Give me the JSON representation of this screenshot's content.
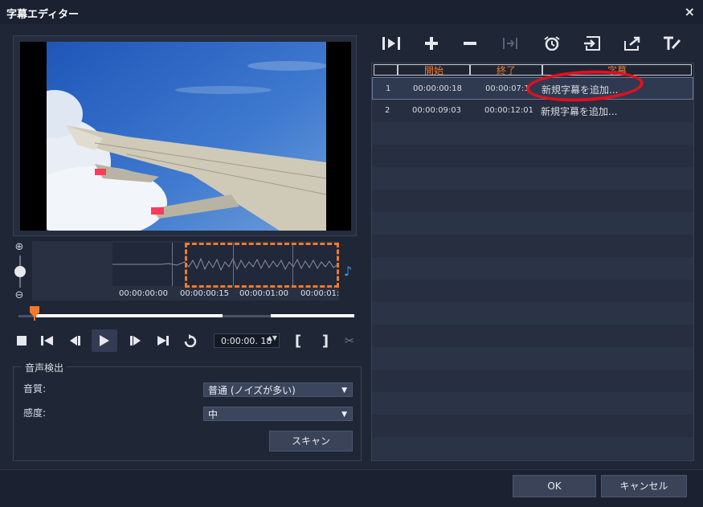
{
  "window": {
    "title": "字幕エディター",
    "close_glyph": "×"
  },
  "timeline": {
    "ticks": [
      "00:00:00:00",
      "00:00:00:15",
      "00:00:01:00",
      "00:00:01:"
    ]
  },
  "timecode": {
    "value": "0:00:00. 18",
    "spin_glyph": "▲▼"
  },
  "audio_detection": {
    "title": "音声検出",
    "quality_label": "音質:",
    "quality_value": "普通 (ノイズが多い)",
    "sensitivity_label": "感度:",
    "sensitivity_value": "中",
    "scan_button": "スキャン"
  },
  "subtitle_list": {
    "columns": [
      "",
      "開始",
      "終了",
      "字幕"
    ],
    "rows": [
      {
        "index": "1",
        "start": "00:00:00:18",
        "end": "00:00:07:1",
        "text": "新規字幕を追加..."
      },
      {
        "index": "2",
        "start": "00:00:09:03",
        "end": "00:00:12:01",
        "text": "新規字幕を追加..."
      }
    ]
  },
  "footer": {
    "ok": "OK",
    "cancel": "キャンセル"
  },
  "colors": {
    "accent": "#f07a2c",
    "highlight": "#e01020",
    "background": "#1f2636"
  }
}
